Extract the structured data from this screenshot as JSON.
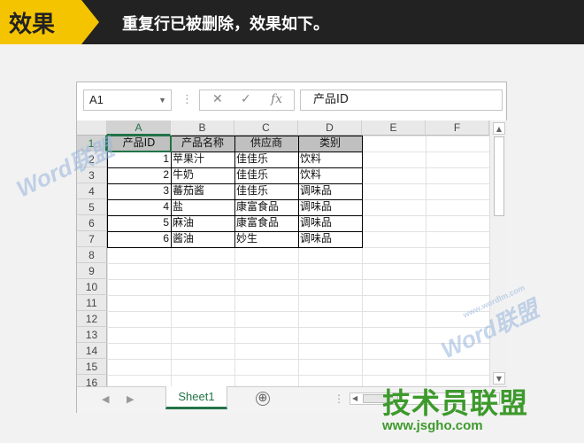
{
  "banner": {
    "tag": "效果",
    "text": "重复行已被删除，效果如下。"
  },
  "formula_bar": {
    "cell_ref": "A1",
    "content": "产品ID",
    "cancel_icon": "✕",
    "enter_icon": "✓",
    "fx_label": "fx"
  },
  "columns": [
    "A",
    "B",
    "C",
    "D",
    "E",
    "F"
  ],
  "rows": [
    "1",
    "2",
    "3",
    "4",
    "5",
    "6",
    "7",
    "8",
    "9",
    "10",
    "11",
    "12",
    "13",
    "14",
    "15",
    "16"
  ],
  "table": {
    "headers": [
      "产品ID",
      "产品名称",
      "供应商",
      "类别"
    ],
    "rows": [
      [
        "1",
        "苹果汁",
        "佳佳乐",
        "饮料"
      ],
      [
        "2",
        "牛奶",
        "佳佳乐",
        "饮料"
      ],
      [
        "3",
        "蕃茄酱",
        "佳佳乐",
        "调味品"
      ],
      [
        "4",
        "盐",
        "康富食品",
        "调味品"
      ],
      [
        "5",
        "麻油",
        "康富食品",
        "调味品"
      ],
      [
        "6",
        "酱油",
        "妙生",
        "调味品"
      ]
    ]
  },
  "sheet_tabs": {
    "active": "Sheet1",
    "add_icon": "⊕"
  },
  "watermarks": {
    "left": "Word联盟",
    "right": "Word联盟",
    "url": "www.wordlm.com"
  },
  "logo": {
    "name": "技术员联盟",
    "url": "www.jsgho.com"
  },
  "colors": {
    "accent": "#217346",
    "banner_tag": "#f5c400",
    "logo_green": "#3d9a2c",
    "header_fill": "#c0c0c0"
  }
}
